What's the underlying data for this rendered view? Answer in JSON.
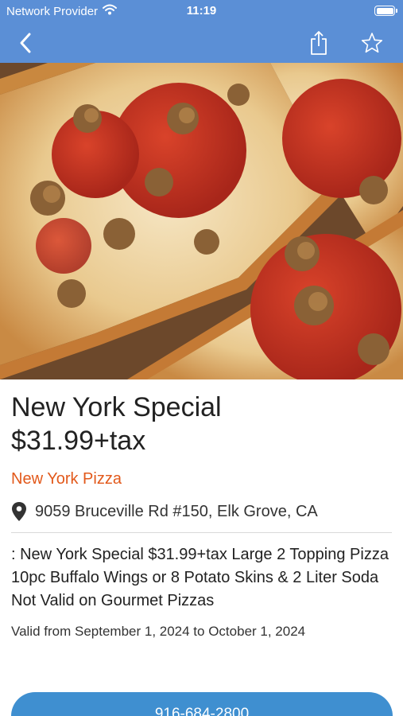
{
  "status_bar": {
    "carrier": "Network Provider",
    "time": "11:19",
    "wifi_icon": "wifi-icon",
    "battery_icon": "battery-icon"
  },
  "nav": {
    "back_icon": "chevron-left-icon",
    "share_icon": "share-icon",
    "favorite_icon": "star-outline-icon"
  },
  "colors": {
    "header": "#5b8fd6",
    "accent": "#e2591b",
    "button": "#3f8fd0"
  },
  "deal": {
    "image": "pepperoni-sausage-pizza-photo",
    "title": "New York Special",
    "price": "$31.99+tax",
    "restaurant": "New York Pizza",
    "location_icon": "map-pin-icon",
    "address": "9059 Bruceville Rd #150, Elk Grove, CA",
    "description": ": New York Special $31.99+tax Large 2 Topping Pizza 10pc Buffalo Wings or 8 Potato Skins & 2 Liter Soda Not Valid on Gourmet Pizzas",
    "validity": "Valid from September 1, 2024 to October 1, 2024",
    "phone": "916-684-2800"
  }
}
